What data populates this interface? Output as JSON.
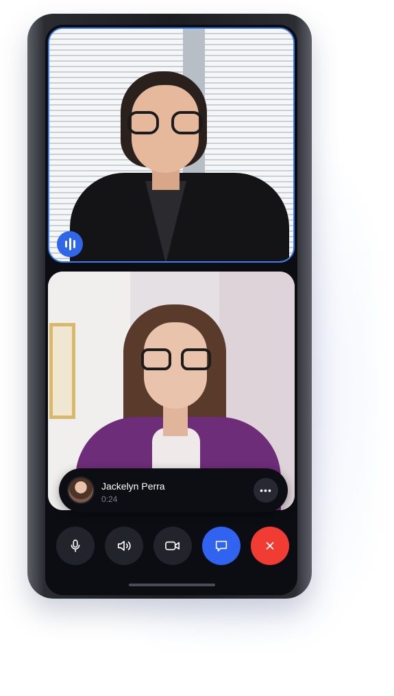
{
  "call": {
    "caller_name": "Jackelyn Perra",
    "duration": "0:24",
    "more_label": "•••"
  },
  "speaking_indicator": {
    "icon": "audio-wave-icon",
    "color": "#2f67e8"
  },
  "controls": [
    {
      "name": "mic",
      "icon": "microphone-icon"
    },
    {
      "name": "speaker",
      "icon": "speaker-icon"
    },
    {
      "name": "video",
      "icon": "video-camera-icon"
    },
    {
      "name": "chat",
      "icon": "chat-bubble-icon",
      "color": "#2f63f0"
    },
    {
      "name": "end-call",
      "icon": "close-icon",
      "color": "#f03c32"
    }
  ],
  "colors": {
    "active_border": "#3b7cf0",
    "screen_bg": "#0c0d12"
  }
}
